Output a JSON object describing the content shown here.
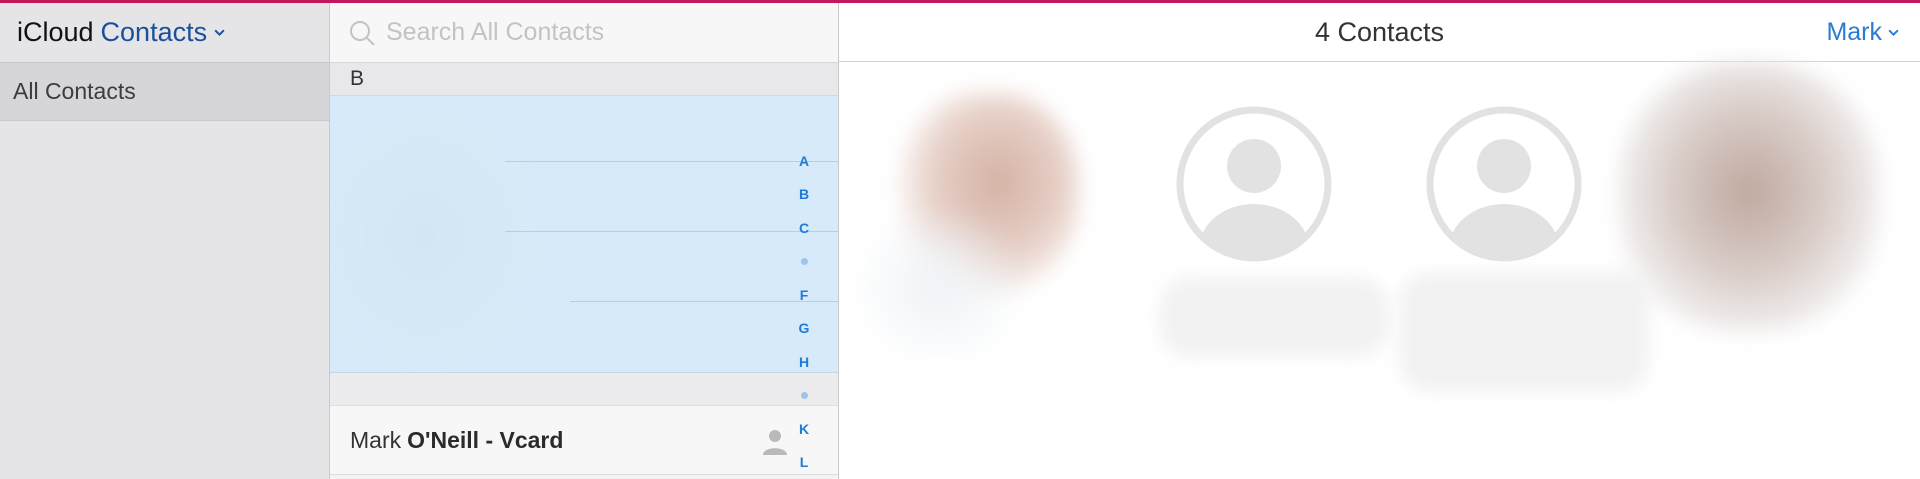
{
  "app": {
    "brand": "iCloud",
    "product": "Contacts"
  },
  "sidebar": {
    "groups": [
      {
        "label": "All Contacts"
      }
    ]
  },
  "search": {
    "placeholder": "Search All Contacts",
    "value": ""
  },
  "list": {
    "section_letter": "B",
    "index_letters": [
      "A",
      "B",
      "C",
      "•",
      "F",
      "G",
      "H",
      "•",
      "K",
      "L"
    ],
    "contact": {
      "first_name": "Mark",
      "last_name": "O'Neill - Vcard"
    }
  },
  "main": {
    "count_label": "4 Contacts",
    "account_label": "Mark"
  },
  "colors": {
    "accent": "#2a7bd3",
    "brand_blue": "#1a4f9c",
    "selection": "#d7eaf9",
    "top_bar": "#c2185b"
  },
  "icons": [
    "chevron-down-icon",
    "search-icon",
    "person-icon",
    "avatar-placeholder-icon"
  ]
}
